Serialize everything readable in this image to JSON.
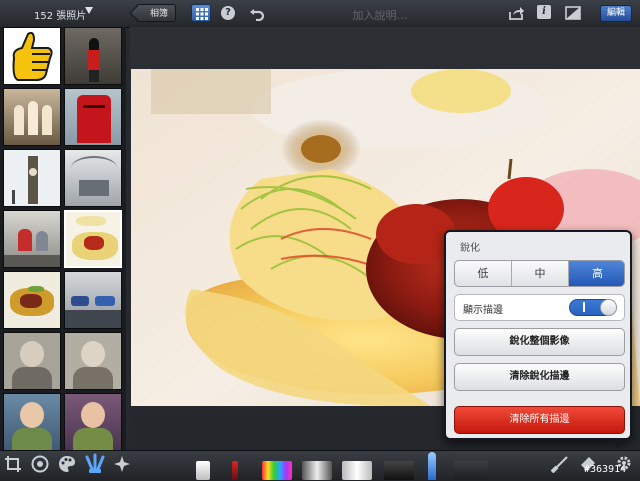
{
  "topbar": {
    "album_count": "152 張照片",
    "back_label": "相簿",
    "caption_placeholder": "加入說明…",
    "edit_label": "編輯"
  },
  "icons": {
    "album_menu": "chevron-down-icon",
    "grid": "grid-icon",
    "help": "help-icon",
    "undo": "undo-icon",
    "share": "share-icon",
    "info": "info-icon",
    "compare": "compare-icon",
    "crop": "crop-icon",
    "color": "color-wheel-icon",
    "palette": "palette-icon",
    "brushes": "brushes-icon",
    "effects": "sparkle-icon",
    "brush_edit": "brush-edit-icon",
    "eraser": "eraser-icon",
    "settings": "gear-icon"
  },
  "thumbnails": [
    "thumb-thumbs-up",
    "thumb-guard",
    "thumb-church",
    "thumb-postbox",
    "thumb-big-ben",
    "thumb-station",
    "thumb-kids",
    "thumb-dessert",
    "thumb-food",
    "thumb-street",
    "thumb-child-1",
    "thumb-child-2",
    "thumb-child-3",
    "thumb-child-4"
  ],
  "popover": {
    "title": "銳化",
    "segments": [
      "低",
      "中",
      "高"
    ],
    "selected_segment": "高",
    "toggle_label": "顯示描邊",
    "toggle_state": "I",
    "sharpen_all": "銳化整個影像",
    "clear_sharpen": "清除銳化描邊",
    "clear_all": "清除所有描邊"
  },
  "watermark": "#363914",
  "colors": {
    "accent": "#2f64bd",
    "danger": "#d82a1b"
  }
}
